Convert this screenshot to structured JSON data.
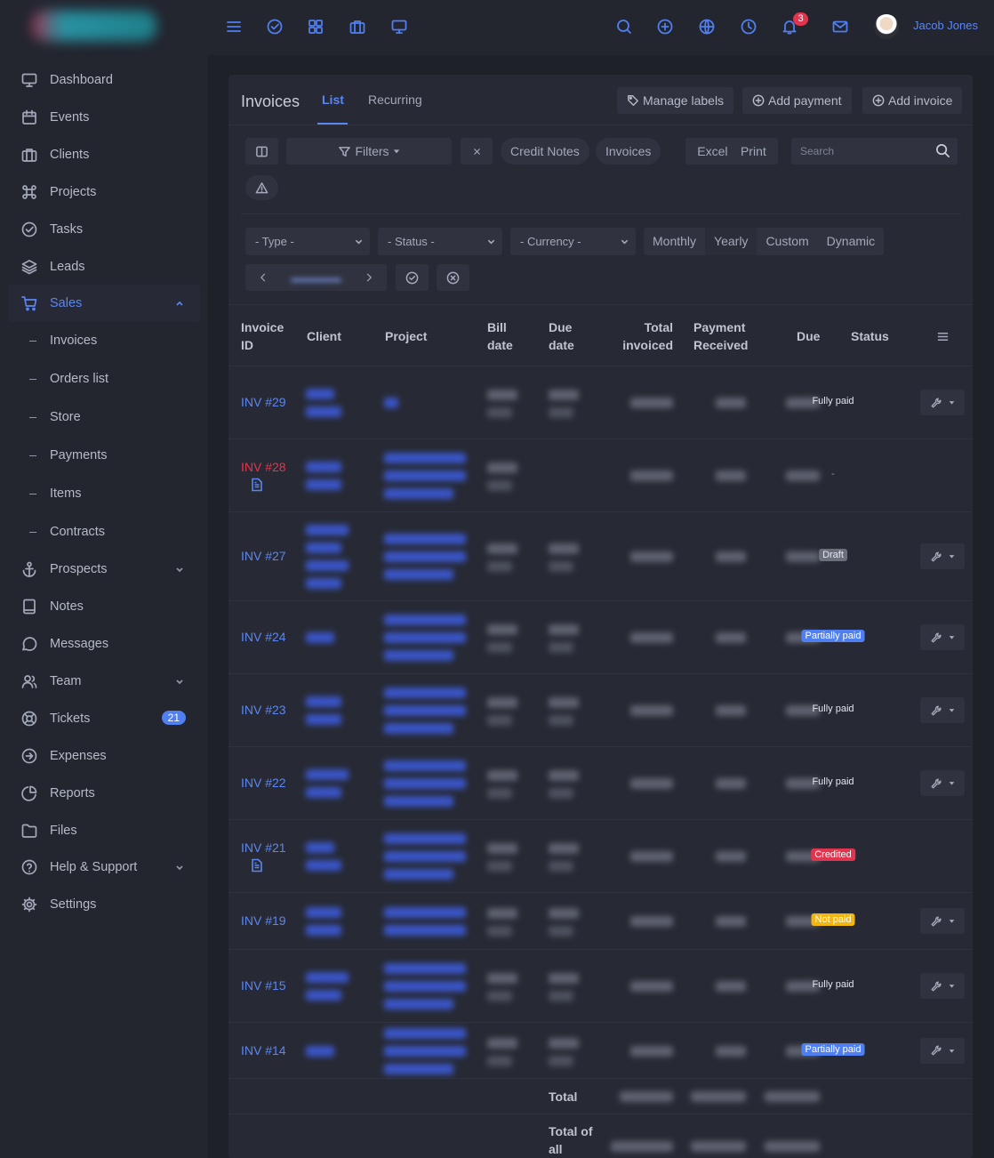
{
  "user": {
    "name": "Jacob Jones"
  },
  "notifications": {
    "count": "3"
  },
  "sidebar": {
    "items": [
      {
        "label": "Dashboard"
      },
      {
        "label": "Events"
      },
      {
        "label": "Clients"
      },
      {
        "label": "Projects"
      },
      {
        "label": "Tasks"
      },
      {
        "label": "Leads"
      },
      {
        "label": "Sales"
      },
      {
        "label": "Prospects"
      },
      {
        "label": "Notes"
      },
      {
        "label": "Messages"
      },
      {
        "label": "Team"
      },
      {
        "label": "Tickets",
        "badge": "21"
      },
      {
        "label": "Expenses"
      },
      {
        "label": "Reports"
      },
      {
        "label": "Files"
      },
      {
        "label": "Help & Support"
      },
      {
        "label": "Settings"
      }
    ],
    "sales_sub": [
      {
        "label": "Invoices"
      },
      {
        "label": "Orders list"
      },
      {
        "label": "Store"
      },
      {
        "label": "Payments"
      },
      {
        "label": "Items"
      },
      {
        "label": "Contracts"
      }
    ]
  },
  "page": {
    "title": "Invoices",
    "tabs": [
      "List",
      "Recurring"
    ],
    "actions": {
      "manage_labels": "Manage labels",
      "add_payment": "Add payment",
      "add_invoice": "Add invoice"
    }
  },
  "toolbar": {
    "filters": "Filters",
    "credit_notes": "Credit Notes",
    "invoices": "Invoices",
    "excel": "Excel",
    "print": "Print",
    "search_placeholder": "Search"
  },
  "filters": {
    "type": "- Type -",
    "status": "- Status -",
    "currency": "- Currency -",
    "periods": [
      "Monthly",
      "Yearly",
      "Custom",
      "Dynamic"
    ],
    "active_period": "Yearly"
  },
  "table": {
    "headers": {
      "invoice_id": [
        "Invoice",
        "ID"
      ],
      "client": "Client",
      "project": "Project",
      "bill_date": [
        "Bill",
        "date"
      ],
      "due_date": [
        "Due",
        "date"
      ],
      "total_invoiced": [
        "Total",
        "invoiced"
      ],
      "payment_received": [
        "Payment",
        "Received"
      ],
      "due": "Due",
      "status": "Status"
    },
    "rows": [
      {
        "id": "INV #29",
        "status": "Fully paid",
        "status_type": "fully"
      },
      {
        "id": "INV #28",
        "status": "-",
        "status_type": "dash"
      },
      {
        "id": "INV #27",
        "status": "Draft",
        "status_type": "draft"
      },
      {
        "id": "INV #24",
        "status": "Partially paid",
        "status_type": "partial"
      },
      {
        "id": "INV #23",
        "status": "Fully paid",
        "status_type": "fully"
      },
      {
        "id": "INV #22",
        "status": "Fully paid",
        "status_type": "fully"
      },
      {
        "id": "INV #21",
        "status": "Credited",
        "status_type": "credited"
      },
      {
        "id": "INV #19",
        "status": "Not paid",
        "status_type": "notpaid"
      },
      {
        "id": "INV #15",
        "status": "Fully paid",
        "status_type": "fully"
      },
      {
        "id": "INV #14",
        "status": "Partially paid",
        "status_type": "partial"
      }
    ],
    "footer": {
      "total": "Total",
      "total_of_all": [
        "Total of",
        "all"
      ]
    }
  },
  "colors": {
    "accent": "#4f7ff0",
    "danger": "#e0344f",
    "warning": "#f2b611",
    "background": "#1f2129",
    "surface": "#272a34"
  }
}
